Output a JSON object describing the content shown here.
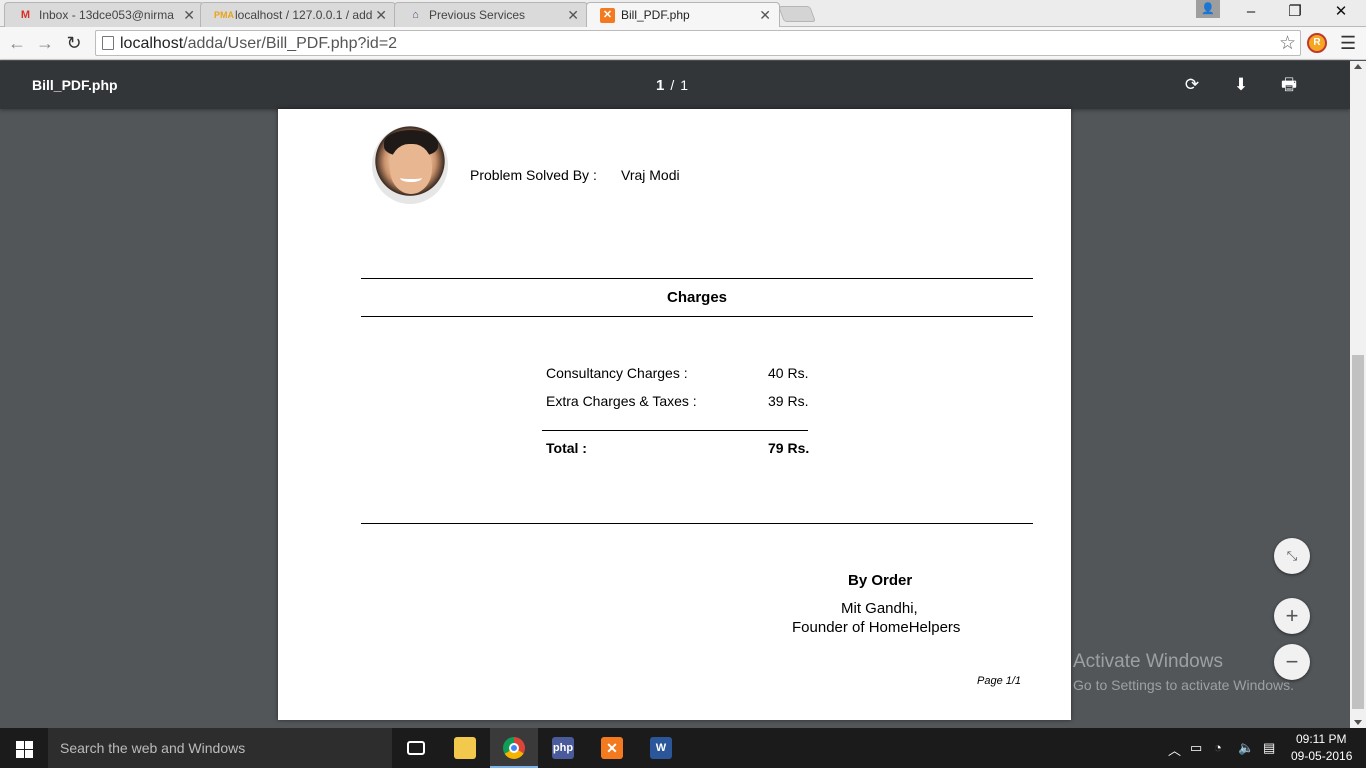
{
  "browser": {
    "tabs": [
      {
        "title": "Inbox - 13dce053@nirma",
        "favicon": "gmail-icon",
        "color": "#d93025"
      },
      {
        "title": "localhost / 127.0.0.1 / add",
        "favicon": "phpmyadmin-icon",
        "color": "#e8a317"
      },
      {
        "title": "Previous Services",
        "favicon": "house-icon",
        "color": "#6a3d7a"
      },
      {
        "title": "Bill_PDF.php",
        "favicon": "xampp-icon",
        "color": "#f47a20"
      }
    ],
    "url_host": "localhost",
    "url_path": "/adda/User/Bill_PDF.php?id=2"
  },
  "pdf_viewer": {
    "title": "Bill_PDF.php",
    "current_page": "1",
    "page_separator": "/",
    "total_pages": "1"
  },
  "bill": {
    "solved_by_label": "Problem Solved By :",
    "solved_by_name": "Vraj Modi",
    "charges_heading": "Charges",
    "rows": [
      {
        "label": "Consultancy Charges :",
        "value": "40 Rs."
      },
      {
        "label": "Extra Charges & Taxes :",
        "value": "39 Rs."
      }
    ],
    "total_label": "Total :",
    "total_value": "79 Rs.",
    "by_order": "By Order",
    "signatory_name": "Mit Gandhi,",
    "signatory_role": "Founder of HomeHelpers",
    "page_footer": "Page 1/1"
  },
  "watermark": {
    "line1": "Activate Windows",
    "line2": "Go to Settings to activate Windows."
  },
  "taskbar": {
    "search_placeholder": "Search the web and Windows",
    "time": "09:11 PM",
    "date": "09-05-2016"
  }
}
